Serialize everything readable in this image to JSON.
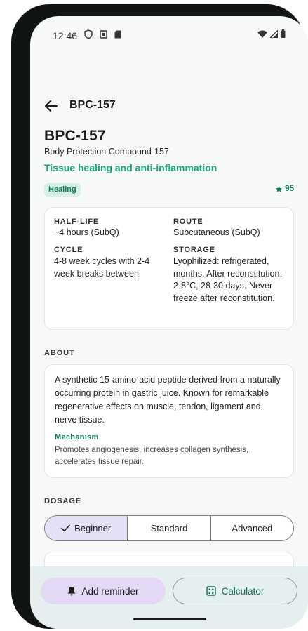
{
  "status_bar": {
    "time": "12:46"
  },
  "app_bar": {
    "title": "BPC-157"
  },
  "header": {
    "title": "BPC-157",
    "full_name": "Body Protection Compound-157",
    "tagline": "Tissue healing and anti-inflammation",
    "category_chip": "Healing",
    "rating": "95"
  },
  "info": {
    "half_life_label": "HALF-LIFE",
    "half_life_value": "~4 hours (SubQ)",
    "route_label": "ROUTE",
    "route_value": "Subcutaneous (SubQ)",
    "cycle_label": "CYCLE",
    "cycle_value": "4-8 week cycles with 2-4 week breaks between",
    "storage_label": "STORAGE",
    "storage_value": "Lyophilized: refrigerated, months. After reconstitution: 2-8°C, 28-30 days. Never freeze after reconstitution."
  },
  "about": {
    "heading": "ABOUT",
    "text": "A synthetic 15-amino-acid peptide derived from a naturally occurring protein in gastric juice. Known for remarkable regenerative effects on muscle, tendon, ligament and nerve tissue.",
    "mechanism_label": "Mechanism",
    "mechanism_text": "Promotes angiogenesis, increases collagen synthesis, accelerates tissue repair."
  },
  "dosage": {
    "heading": "DOSAGE",
    "tabs": [
      "Beginner",
      "Standard",
      "Advanced"
    ],
    "selected": "Beginner"
  },
  "actions": {
    "reminder_label": "Add reminder",
    "calculator_label": "Calculator"
  },
  "colors": {
    "accent_green": "#1aa37f",
    "chip_bg": "#d3f1e6",
    "segment_selected_bg": "#e6e0f6",
    "reminder_bg": "#e3d9f4",
    "bottom_bar_bg": "#e6efef"
  },
  "icons": [
    "vpn-key-icon",
    "sim-icon",
    "sd-card-icon",
    "wifi-icon",
    "signal-icon",
    "battery-icon",
    "back-arrow-icon",
    "star-icon",
    "check-icon",
    "bell-icon",
    "calculator-icon"
  ]
}
